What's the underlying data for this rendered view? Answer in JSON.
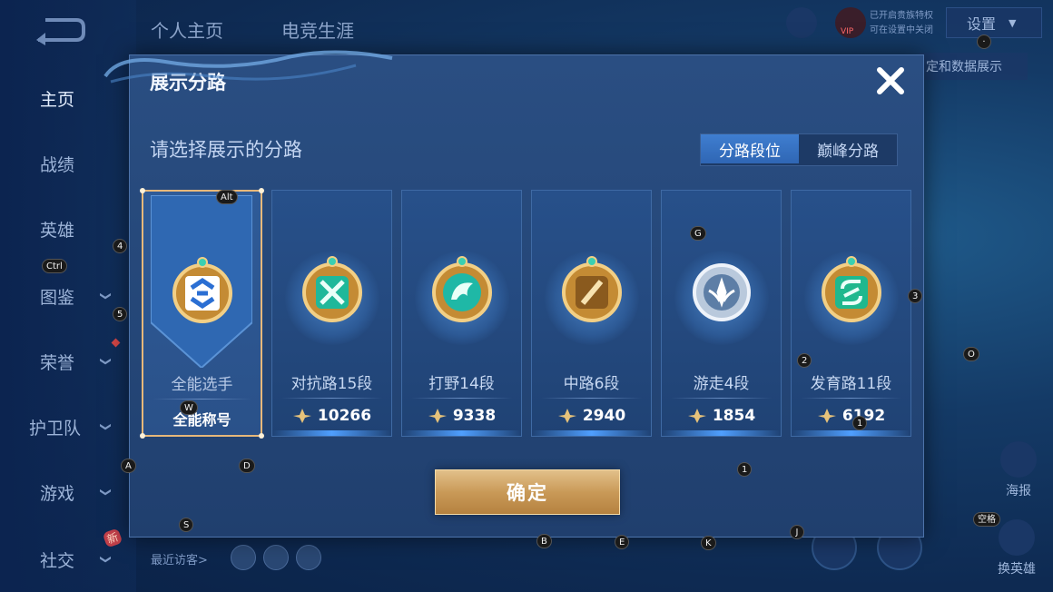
{
  "background": {
    "top_tabs": [
      "个人主页",
      "电竞生涯"
    ],
    "sidebar": [
      {
        "label": "主页",
        "chevron": false
      },
      {
        "label": "战绩",
        "chevron": false
      },
      {
        "label": "英雄",
        "chevron": false
      },
      {
        "label": "图鉴",
        "chevron": true
      },
      {
        "label": "荣誉",
        "chevron": true
      },
      {
        "label": "护卫队",
        "chevron": true
      },
      {
        "label": "游戏",
        "chevron": true
      },
      {
        "label": "社交",
        "chevron": true
      }
    ],
    "new_badge": "新",
    "settings_label": "设置",
    "data_show_label": "定和数据展示",
    "vip_label": "VIP",
    "vip_text_1": "已开启贵族特权",
    "vip_text_2": "可在设置中关闭",
    "poster_label": "海报",
    "switch_hero_label": "换英雄",
    "recent_visitors_label": "最近访客>"
  },
  "modal": {
    "title": "展示分路",
    "subtitle": "请选择展示的分路",
    "toggle": {
      "options": [
        "分路段位",
        "巅峰分路"
      ],
      "selected": 0
    },
    "cards": [
      {
        "name": "全能选手",
        "value": "全能称号",
        "emblem": "all-round-emblem-icon",
        "selected": true,
        "color": "#2b6fd3"
      },
      {
        "name": "对抗路15段",
        "value": "10266",
        "emblem": "clash-lane-emblem-icon",
        "selected": false,
        "color": "#1fb89a"
      },
      {
        "name": "打野14段",
        "value": "9338",
        "emblem": "jungle-emblem-icon",
        "selected": false,
        "color": "#1fb8a6"
      },
      {
        "name": "中路6段",
        "value": "2940",
        "emblem": "mid-lane-emblem-icon",
        "selected": false,
        "color": "#d09a3c"
      },
      {
        "name": "游走4段",
        "value": "1854",
        "emblem": "roam-emblem-icon",
        "selected": false,
        "color": "#8fa8c8"
      },
      {
        "name": "发育路11段",
        "value": "6192",
        "emblem": "farm-lane-emblem-icon",
        "selected": false,
        "color": "#1fb88e"
      }
    ],
    "confirm_label": "确定"
  },
  "key_hints": [
    "Alt",
    "4",
    "Ctrl",
    "5",
    "W",
    "A",
    "D",
    "S",
    "G",
    "3",
    "2",
    "O",
    "1",
    "1",
    "B",
    "E",
    "K",
    "J",
    "空格",
    "·"
  ]
}
